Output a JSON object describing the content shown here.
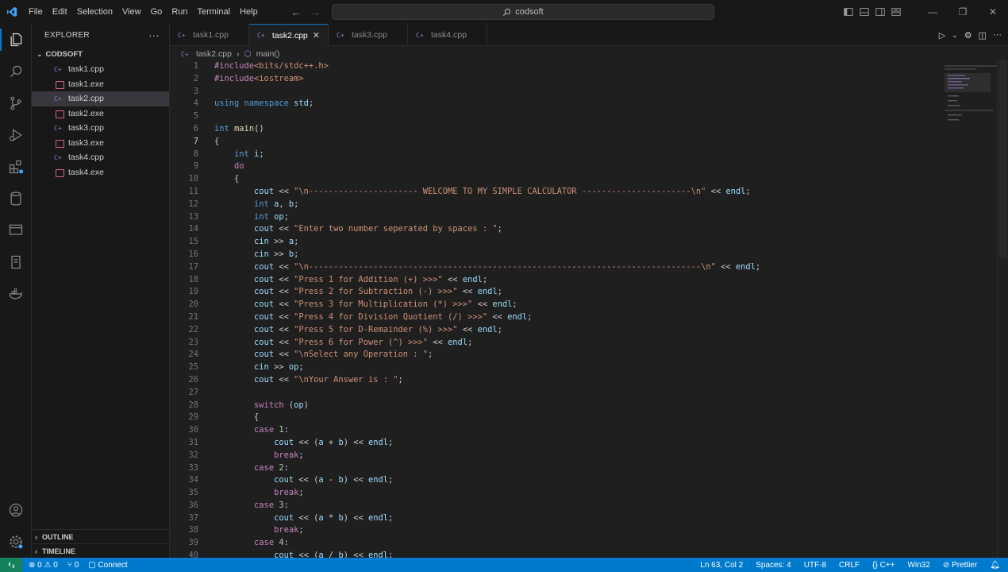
{
  "titlebar": {
    "menu": [
      "File",
      "Edit",
      "Selection",
      "View",
      "Go",
      "Run",
      "Terminal",
      "Help"
    ],
    "search_text": "codsoft"
  },
  "sidebar": {
    "title": "EXPLORER",
    "folder": "CODSOFT",
    "files": [
      {
        "name": "task1.cpp",
        "type": "cpp"
      },
      {
        "name": "task1.exe",
        "type": "exe"
      },
      {
        "name": "task2.cpp",
        "type": "cpp",
        "selected": true
      },
      {
        "name": "task2.exe",
        "type": "exe"
      },
      {
        "name": "task3.cpp",
        "type": "cpp"
      },
      {
        "name": "task3.exe",
        "type": "exe"
      },
      {
        "name": "task4.cpp",
        "type": "cpp"
      },
      {
        "name": "task4.exe",
        "type": "exe"
      }
    ],
    "outline_label": "OUTLINE",
    "timeline_label": "TIMELINE"
  },
  "tabs": [
    {
      "label": "task1.cpp",
      "active": false
    },
    {
      "label": "task2.cpp",
      "active": true
    },
    {
      "label": "task3.cpp",
      "active": false
    },
    {
      "label": "task4.cpp",
      "active": false
    }
  ],
  "breadcrumb": {
    "file": "task2.cpp",
    "symbol": "main()"
  },
  "code_lines": [
    "#include<bits/stdc++.h>",
    "#include<iostream>",
    "",
    "using namespace std;",
    "",
    "int main()",
    "{",
    "    int i;",
    "    do",
    "    {",
    "        cout << \"\\n---------------------- WELCOME TO MY SIMPLE CALCULATOR ----------------------\\n\" << endl;",
    "        int a, b;",
    "        int op;",
    "        cout << \"Enter two number seperated by spaces : \";",
    "        cin >> a;",
    "        cin >> b;",
    "        cout << \"\\n-------------------------------------------------------------------------------\\n\" << endl;",
    "        cout << \"Press 1 for Addition (+) >>>\" << endl;",
    "        cout << \"Press 2 for Subtraction (-) >>>\" << endl;",
    "        cout << \"Press 3 for Multiplication (*) >>>\" << endl;",
    "        cout << \"Press 4 for Division Quotient (/) >>>\" << endl;",
    "        cout << \"Press 5 for D-Remainder (%) >>>\" << endl;",
    "        cout << \"Press 6 for Power (^) >>>\" << endl;",
    "        cout << \"\\nSelect any Operation : \";",
    "        cin >> op;",
    "        cout << \"\\nYour Answer is : \";",
    "",
    "        switch (op)",
    "        {",
    "        case 1:",
    "            cout << (a + b) << endl;",
    "            break;",
    "        case 2:",
    "            cout << (a - b) << endl;",
    "            break;",
    "        case 3:",
    "            cout << (a * b) << endl;",
    "            break;",
    "        case 4:",
    "            cout << (a / b) << endl;"
  ],
  "status": {
    "errors": "0",
    "warnings": "0",
    "ports": "0",
    "connect": "Connect",
    "position": "Ln 63, Col 2",
    "spaces": "Spaces: 4",
    "encoding": "UTF-8",
    "eol": "CRLF",
    "language": "C++",
    "platform": "Win32",
    "formatter": "Prettier"
  },
  "colors": {
    "keyword": "#569cd6",
    "control": "#c586c0",
    "string": "#ce9178",
    "number": "#b5cea8",
    "function": "#dcdcaa",
    "variable": "#9cdcfe",
    "accent": "#007acc"
  },
  "icons": {
    "activity": [
      "files-icon",
      "search-icon",
      "source-control-icon",
      "run-debug-icon",
      "extensions-icon",
      "database-icon",
      "remote-explorer-icon",
      "testing-icon",
      "docker-icon",
      "account-icon",
      "settings-gear-icon"
    ]
  }
}
